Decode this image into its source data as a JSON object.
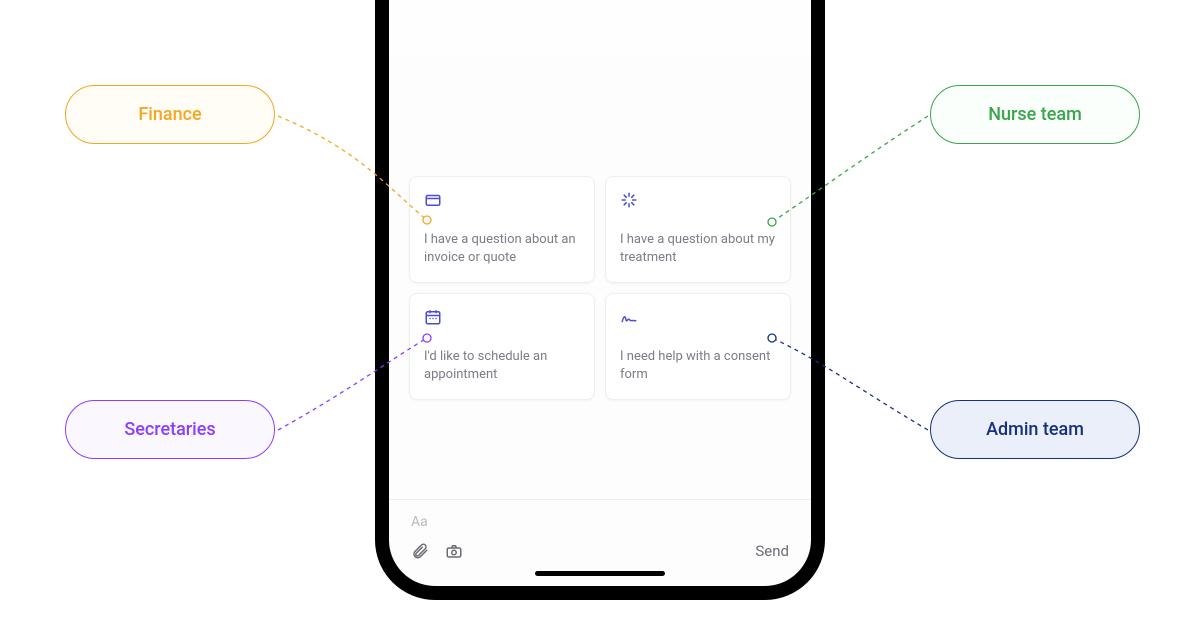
{
  "cards": [
    {
      "icon": "invoice-icon",
      "text": "I have a question about an invoice or quote"
    },
    {
      "icon": "treatment-icon",
      "text": "I have a question about my treatment"
    },
    {
      "icon": "calendar-icon",
      "text": "I'd like to schedule an appointment"
    },
    {
      "icon": "signature-icon",
      "text": "I need help with a consent form"
    }
  ],
  "composer": {
    "placeholder": "Aa",
    "send_label": "Send"
  },
  "callouts": {
    "finance": "Finance",
    "nurse": "Nurse team",
    "secretaries": "Secretaries",
    "admin": "Admin team"
  },
  "colors": {
    "finance": "#f5a623",
    "nurse": "#3aa54b",
    "secretaries": "#8a3ffc",
    "admin": "#17317e",
    "card_icon": "#4b4bd4"
  }
}
